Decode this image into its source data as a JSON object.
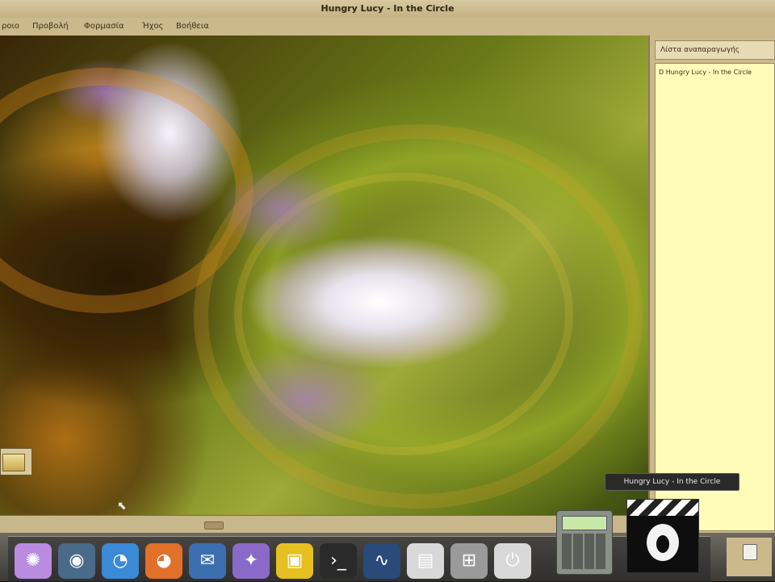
{
  "window": {
    "title": "Hungry Lucy - In the Circle"
  },
  "menu": {
    "items": [
      "ροιο",
      "Προβολή",
      "Φορμασία",
      "Ήχος",
      "Βοήθεια"
    ]
  },
  "playlist": {
    "header": "Λίστα αναπαραγωγής",
    "items": [
      {
        "label": "D  Hungry Lucy - In the Circle"
      }
    ]
  },
  "tooltip": {
    "text": "Hungry Lucy - In the Circle"
  },
  "dock": {
    "icons": [
      {
        "name": "gnome-menu-icon",
        "color": "#b98ce0",
        "glyph": "✺"
      },
      {
        "name": "globe-icon",
        "color": "#4a6a8a",
        "glyph": "◉"
      },
      {
        "name": "web-browser-icon",
        "color": "#3a8ad6",
        "glyph": "◔"
      },
      {
        "name": "firefox-icon",
        "color": "#e0702a",
        "glyph": "◕"
      },
      {
        "name": "thunderbird-icon",
        "color": "#3d6fb0",
        "glyph": "✉"
      },
      {
        "name": "pidgin-icon",
        "color": "#8a6ac8",
        "glyph": "✦"
      },
      {
        "name": "office-icon",
        "color": "#e6c020",
        "glyph": "▣"
      },
      {
        "name": "terminal-icon",
        "color": "#2a2a2a",
        "glyph": "›_"
      },
      {
        "name": "system-monitor-icon",
        "color": "#2a4a7a",
        "glyph": "∿"
      },
      {
        "name": "file-manager-icon",
        "color": "#d8d8d8",
        "glyph": "▤"
      },
      {
        "name": "network-icon",
        "color": "#9a9a9a",
        "glyph": "⊞"
      },
      {
        "name": "power-icon",
        "color": "#d8d8d8",
        "glyph": "⏻"
      }
    ]
  }
}
